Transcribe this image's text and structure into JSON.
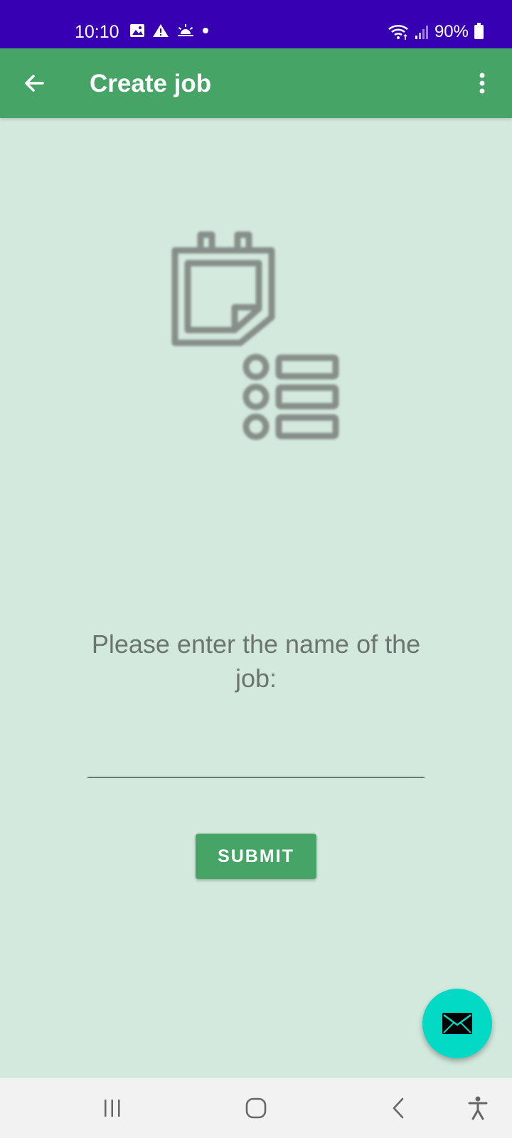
{
  "status_bar": {
    "time": "10:10",
    "battery": "90%",
    "icons_left": [
      "image-icon",
      "warning-icon",
      "sunrise-icon",
      "dot-icon"
    ],
    "icons_right": [
      "wifi-icon",
      "signal-icon",
      "battery-icon"
    ]
  },
  "app_bar": {
    "title": "Create job",
    "back_icon": "arrow-left-icon",
    "menu_icon": "more-vertical-icon"
  },
  "main": {
    "illustration_icon": "calendar-list-icon",
    "prompt": "Please enter the name of the job:",
    "job_name_input": {
      "value": "",
      "placeholder": ""
    },
    "submit_label": "SUBMIT"
  },
  "fab": {
    "icon": "mail-icon"
  },
  "nav_bar": {
    "items": [
      "recent-apps-icon",
      "home-icon",
      "back-icon",
      "accessibility-icon"
    ]
  },
  "colors": {
    "status_bar": "#3700b3",
    "app_bar": "#46a467",
    "background": "#d4e9de",
    "fab": "#03dac6",
    "submit_button": "#46a467"
  }
}
